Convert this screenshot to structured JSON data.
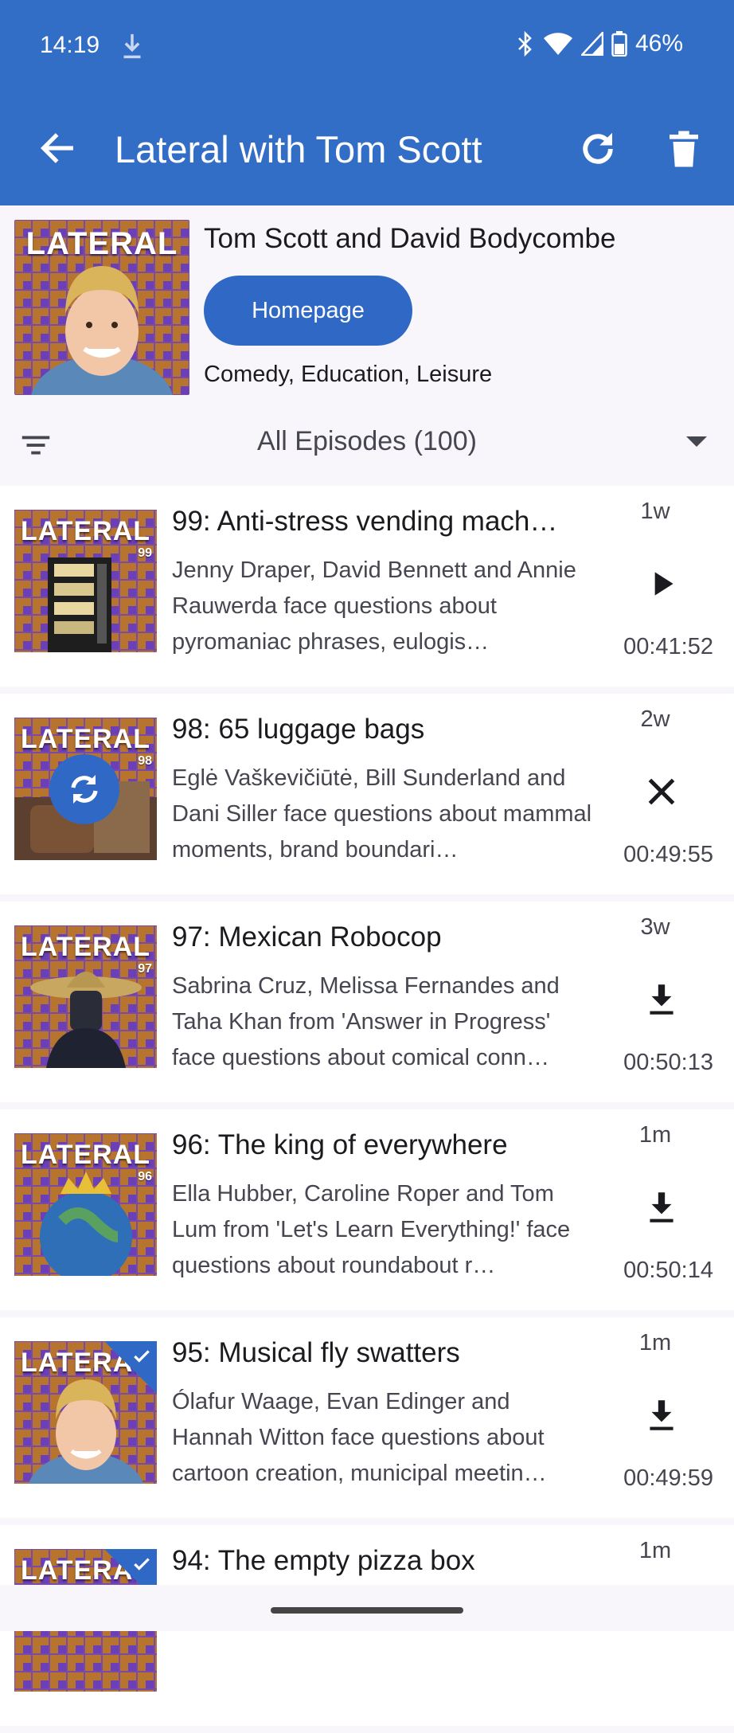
{
  "status_bar": {
    "time": "14:19",
    "battery": "46%",
    "icons": [
      "download-icon",
      "bluetooth-icon",
      "wifi-icon",
      "signal-icon",
      "battery-icon"
    ]
  },
  "app_bar": {
    "title": "Lateral with Tom Scott",
    "icons": [
      "back-arrow-icon",
      "refresh-icon",
      "delete-icon"
    ]
  },
  "podcast": {
    "cover_text": "LATERAL",
    "author": "Tom Scott and David Bodycombe",
    "homepage_label": "Homepage",
    "categories": "Comedy, Education, Leisure"
  },
  "filter": {
    "label": "All Episodes (100)"
  },
  "episodes": [
    {
      "cover_text": "LATERAL",
      "number_badge": "99",
      "title": "99: Anti-stress vending mach…",
      "description": "Jenny Draper, David Bennett and Annie Rauwerda face questions about pyromaniac phrases, eulogis…",
      "age": "1w",
      "action": "play-icon",
      "duration": "00:41:52"
    },
    {
      "cover_text": "LATERAL",
      "number_badge": "98",
      "title": "98: 65 luggage bags",
      "description": "Eglė Vaškevičiūtė, Bill Sunderland and Dani Siller face questions about mammal moments, brand boundari…",
      "age": "2w",
      "action": "cancel-icon",
      "duration": "00:49:55"
    },
    {
      "cover_text": "LATERAL",
      "number_badge": "97",
      "title": "97: Mexican Robocop",
      "description": "Sabrina Cruz, Melissa Fernandes and Taha Khan from 'Answer in Progress' face questions about comical conn…",
      "age": "3w",
      "action": "download-icon",
      "duration": "00:50:13"
    },
    {
      "cover_text": "LATERAL",
      "number_badge": "96",
      "title": "96: The king of everywhere",
      "description": "Ella Hubber, Caroline Roper and Tom Lum from 'Let's Learn Everything!' face questions about roundabout r…",
      "age": "1m",
      "action": "download-icon",
      "duration": "00:50:14"
    },
    {
      "cover_text": "LATERAL",
      "number_badge": "",
      "title": "95: Musical fly swatters",
      "description": "Ólafur Waage, Evan Edinger and Hannah Witton face questions about cartoon creation, municipal meetin…",
      "age": "1m",
      "action": "download-icon",
      "duration": "00:49:59"
    },
    {
      "cover_text": "LATERAL",
      "number_badge": "",
      "title": "94: The empty pizza box",
      "description": "",
      "age": "1m",
      "action": "",
      "duration": ""
    }
  ],
  "colors": {
    "primary": "#326dc6",
    "button": "#3068c5",
    "cover_purple": "#6a3fb8",
    "cover_orange": "#d18a2c"
  }
}
